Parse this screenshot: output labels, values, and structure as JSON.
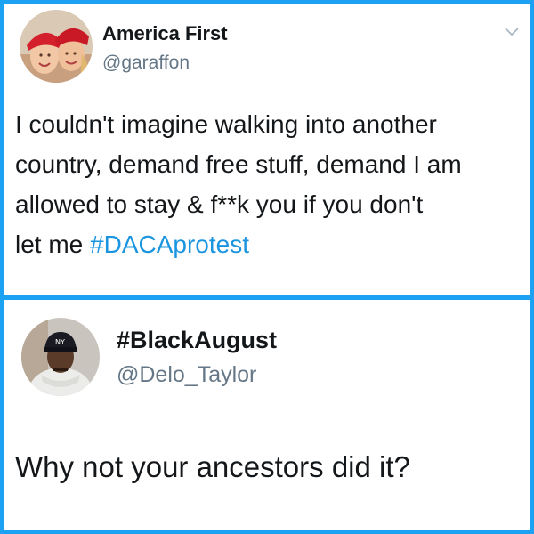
{
  "tweets": [
    {
      "display_name": "America First",
      "handle": "@garaffon",
      "avatar_icon": "avatar-two-women-red-caps",
      "menu_icon": "chevron-down-icon",
      "text_lines": [
        "I couldn't imagine walking into another",
        "country, demand free stuff, demand I am",
        "allowed to stay &  f**k you if you don't",
        "let me "
      ],
      "hashtag": "#DACAprotest"
    },
    {
      "display_name": "#BlackAugust",
      "handle": "@Delo_Taylor",
      "avatar_icon": "avatar-man-cap-scarf",
      "text": "Why not your ancestors did it?"
    }
  ],
  "colors": {
    "background": "#1da1f2",
    "card": "#ffffff",
    "text": "#14171a",
    "handle": "#657786",
    "hashtag": "#1b95e0"
  }
}
